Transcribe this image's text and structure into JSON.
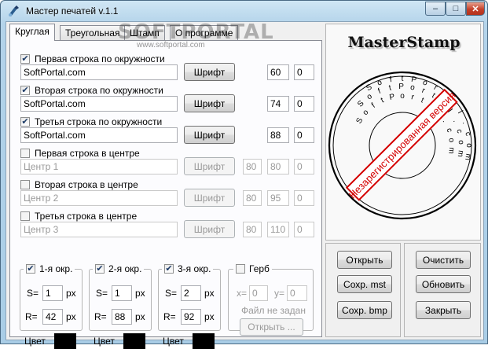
{
  "window": {
    "title": "Мастер печатей v.1.1",
    "controls": {
      "minimize": "–",
      "maximize": "□",
      "close": "✕"
    }
  },
  "watermark": {
    "text": "SOFTPORTAL",
    "url": "www.softportal.com"
  },
  "tabs": [
    {
      "label": "Круглая",
      "active": true
    },
    {
      "label": "Треугольная",
      "active": false
    },
    {
      "label": "Штамп",
      "active": false
    },
    {
      "label": "О программе",
      "active": false
    }
  ],
  "rows": [
    {
      "label": "Первая строка по окружности",
      "checked": true,
      "enabled": true,
      "text": "SoftPortal.com",
      "font_button": "Шрифт",
      "num1": "",
      "num2": "60",
      "num3": "0"
    },
    {
      "label": "Вторая строка по окружности",
      "checked": true,
      "enabled": true,
      "text": "SoftPortal.com",
      "font_button": "Шрифт",
      "num1": "",
      "num2": "74",
      "num3": "0"
    },
    {
      "label": "Третья строка по окружности",
      "checked": true,
      "enabled": true,
      "text": "SoftPortal.com",
      "font_button": "Шрифт",
      "num1": "",
      "num2": "88",
      "num3": "0"
    },
    {
      "label": "Первая строка в центре",
      "checked": false,
      "enabled": false,
      "text": "Центр 1",
      "font_button": "Шрифт",
      "num1": "80",
      "num2": "80",
      "num3": "0"
    },
    {
      "label": "Вторая строка в центре",
      "checked": false,
      "enabled": false,
      "text": "Центр 2",
      "font_button": "Шрифт",
      "num1": "80",
      "num2": "95",
      "num3": "0"
    },
    {
      "label": "Третья строка в центре",
      "checked": false,
      "enabled": false,
      "text": "Центр 3",
      "font_button": "Шрифт",
      "num1": "80",
      "num2": "110",
      "num3": "0"
    }
  ],
  "circles": [
    {
      "label": "1-я окр.",
      "checked": true,
      "s_label": "S=",
      "s_value": "1",
      "r_label": "R=",
      "r_value": "42",
      "unit": "px",
      "color_label": "Цвет",
      "color": "#000000"
    },
    {
      "label": "2-я окр.",
      "checked": true,
      "s_label": "S=",
      "s_value": "1",
      "r_label": "R=",
      "r_value": "88",
      "unit": "px",
      "color_label": "Цвет",
      "color": "#000000"
    },
    {
      "label": "3-я окр.",
      "checked": true,
      "s_label": "S=",
      "s_value": "2",
      "r_label": "R=",
      "r_value": "92",
      "unit": "px",
      "color_label": "Цвет",
      "color": "#000000"
    }
  ],
  "emblem": {
    "label": "Герб",
    "checked": false,
    "x_label": "x=",
    "x_value": "0",
    "y_label": "y=",
    "y_value": "0",
    "no_file": "Файл не задан",
    "open_button": "Открыть ..."
  },
  "preview": {
    "brand": "MasterStamp",
    "banner": "Незарегистрированная версия",
    "ring_letters": [
      "S",
      "o",
      "f",
      "t",
      "P",
      "o",
      "r",
      "t",
      "a",
      "l",
      ".",
      "c",
      "o",
      "m"
    ]
  },
  "actions": {
    "open": "Открыть",
    "save_mst": "Сохр. mst",
    "save_bmp": "Сохр. bmp",
    "clear": "Очистить",
    "refresh": "Обновить",
    "close": "Закрыть"
  }
}
